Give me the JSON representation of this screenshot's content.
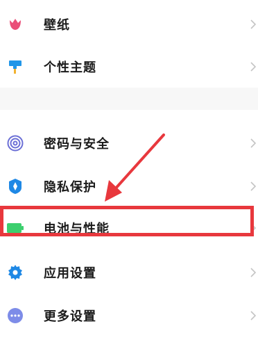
{
  "settings": {
    "items": [
      {
        "label": "壁纸",
        "icon": "tulip-icon",
        "color": "#ea4f78"
      },
      {
        "label": "个性主题",
        "icon": "paint-roller-icon",
        "color": "#2196e8"
      },
      {
        "label": "密码与安全",
        "icon": "fingerprint-icon",
        "color": "#6b6fd6"
      },
      {
        "label": "隐私保护",
        "icon": "shield-icon",
        "color": "#1e88e5"
      },
      {
        "label": "电池与性能",
        "icon": "battery-icon",
        "color": "#3ccf6e"
      },
      {
        "label": "应用设置",
        "icon": "gear-icon",
        "color": "#1e88e5"
      },
      {
        "label": "更多设置",
        "icon": "more-dots-icon",
        "color": "#7d8ce8"
      }
    ]
  },
  "annotation": {
    "highlight_color": "#e8383d",
    "highlighted_item": "电池与性能"
  }
}
